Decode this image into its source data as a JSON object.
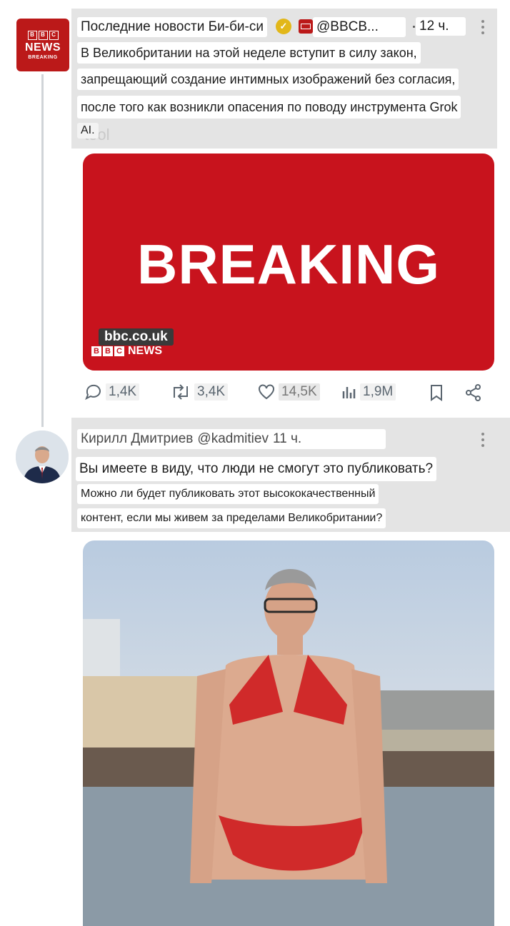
{
  "tweet1": {
    "display_name": "Последние новости Би-би-си",
    "handle": "@BBCB...",
    "time": "12 ч.",
    "text_lines": [
      "В Великобритании на этой неделе вступит в силу закон,",
      "запрещающий создание интимных изображений без согласия,",
      "после того как возникли опасения по поводу инструмента Grok",
      "AI."
    ],
    "text_underlay": "tool",
    "avatar": {
      "line1": "BBC",
      "line2": "NEWS",
      "line3": "BREAKING"
    },
    "media": {
      "headline": "BREAKING",
      "url_tag": "bbc.co.uk",
      "brand_tag": "NEWS",
      "brand_letters": [
        "B",
        "B",
        "C"
      ]
    },
    "stats": {
      "replies": "1,4K",
      "reposts": "3,4K",
      "likes": "14,5K",
      "views": "1,9M"
    },
    "icons": [
      "verified-badge-icon",
      "bbc-affiliate-icon",
      "more-icon",
      "reply-icon",
      "repost-icon",
      "like-icon",
      "views-icon",
      "bookmark-icon",
      "share-icon"
    ]
  },
  "tweet2": {
    "display_name": "Кирилл Дмитриев",
    "handle": "@kadmitiev",
    "time": "11 ч.",
    "text_lines": [
      "Вы имеете в виду, что люди не смогут это публиковать?",
      "Можно ли будет публиковать этот высококачественный",
      "контент, если мы живем за пределами Великобритании?"
    ]
  },
  "colors": {
    "bbc_red": "#bb1919",
    "breaking_red": "#c8131d",
    "icon_grey": "#5b6670",
    "verified_gold": "#e2b719",
    "scrim": "#e4e4e4"
  }
}
